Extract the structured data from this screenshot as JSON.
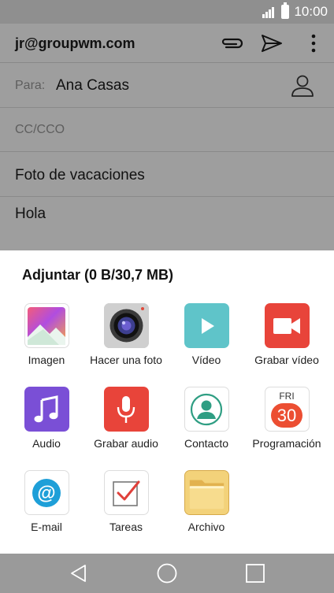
{
  "status_bar": {
    "time": "10:00"
  },
  "app_bar": {
    "account": "jr@groupwm.com",
    "icons": [
      "paperclip-icon",
      "send-icon",
      "more-vert-icon"
    ]
  },
  "compose": {
    "to_label": "Para:",
    "to_value": "Ana Casas",
    "cc_label": "CC/CCO",
    "subject": "Foto de vacaciones",
    "body": "Hola"
  },
  "sheet": {
    "title": "Adjuntar (0 B/30,7 MB)",
    "items": [
      {
        "label": "Imagen",
        "icon": "gallery-icon"
      },
      {
        "label": "Hacer una foto",
        "icon": "camera-icon"
      },
      {
        "label": "Vídeo",
        "icon": "video-icon"
      },
      {
        "label": "Grabar vídeo",
        "icon": "video-record-icon"
      },
      {
        "label": "Audio",
        "icon": "music-icon"
      },
      {
        "label": "Grabar audio",
        "icon": "microphone-icon"
      },
      {
        "label": "Contacto",
        "icon": "contact-icon"
      },
      {
        "label": "Programación",
        "icon": "calendar-icon",
        "calendar_day": "FRI",
        "calendar_date": "30"
      },
      {
        "label": "E-mail",
        "icon": "email-icon"
      },
      {
        "label": "Tareas",
        "icon": "tasks-icon"
      },
      {
        "label": "Archivo",
        "icon": "folder-icon"
      }
    ]
  },
  "colors": {
    "dim_background": "#9e9e9e",
    "sheet_background": "#ffffff",
    "video_teal": "#5fc4c9",
    "record_red": "#e8443a",
    "audio_purple": "#7a4fd6",
    "folder_yellow": "#e9c46a"
  }
}
